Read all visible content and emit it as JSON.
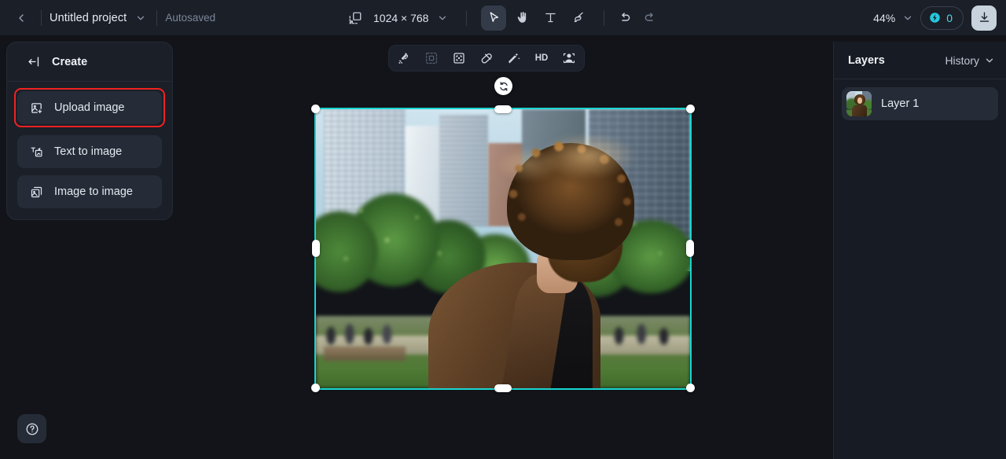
{
  "topbar": {
    "back_icon": "chevron-left-icon",
    "project_name": "Untitled project",
    "project_caret_icon": "chevron-down-icon",
    "autosaved_label": "Autosaved",
    "canvas_size_icon": "canvas-resize-icon",
    "canvas_size": "1024 × 768",
    "canvas_size_caret_icon": "chevron-down-icon",
    "tools": [
      {
        "name": "select-tool",
        "icon": "cursor-arrow-icon",
        "active": true
      },
      {
        "name": "hand-tool",
        "icon": "hand-icon",
        "active": false
      },
      {
        "name": "text-tool",
        "icon": "text-t-icon",
        "active": false
      },
      {
        "name": "brush-tool",
        "icon": "paint-brush-icon",
        "active": false
      }
    ],
    "undo_icon": "undo-arrow-icon",
    "redo_icon": "redo-arrow-icon",
    "zoom_level": "44%",
    "zoom_caret_icon": "chevron-down-icon",
    "credits_icon": "credit-coin-icon",
    "credits_count": "0",
    "credits_color": "#4fd8e8",
    "download_icon": "download-icon"
  },
  "create_panel": {
    "collapse_icon": "collapse-panel-icon",
    "title": "Create",
    "items": [
      {
        "label": "Upload image",
        "icon": "image-upload-icon",
        "highlighted": true
      },
      {
        "label": "Text to image",
        "icon": "text-to-image-icon",
        "highlighted": false
      },
      {
        "label": "Image to image",
        "icon": "image-to-image-icon",
        "highlighted": false
      }
    ],
    "highlight_color": "#f02222"
  },
  "help": {
    "icon": "question-mark-icon"
  },
  "canvas_toolbar": {
    "buttons": [
      {
        "name": "magic-select-tool",
        "icon": "lasso-magic-icon",
        "label": "",
        "dim": false
      },
      {
        "name": "crop-tool",
        "icon": "crop-frame-icon",
        "label": "",
        "dim": true
      },
      {
        "name": "expand-tool",
        "icon": "expand-frame-icon",
        "label": "",
        "dim": false
      },
      {
        "name": "eraser-tool",
        "icon": "eraser-icon",
        "label": "",
        "dim": false
      },
      {
        "name": "magic-wand-tool",
        "icon": "magic-wand-icon",
        "label": "",
        "dim": false
      },
      {
        "name": "upscale-hd-button",
        "icon": "hd-text-icon",
        "label": "HD",
        "dim": false
      },
      {
        "name": "face-enhance-tool",
        "icon": "portrait-person-icon",
        "label": "",
        "dim": false
      }
    ]
  },
  "canvas": {
    "selection_color": "#18d6d1",
    "rotate_icon": "rotate-handle-icon",
    "image_alt": "Person with curly hair in brown blazer standing in a city park"
  },
  "layers_panel": {
    "title": "Layers",
    "history_label": "History",
    "history_caret_icon": "chevron-down-icon",
    "layers": [
      {
        "name": "Layer 1",
        "thumb": "layer-thumbnail"
      }
    ]
  }
}
